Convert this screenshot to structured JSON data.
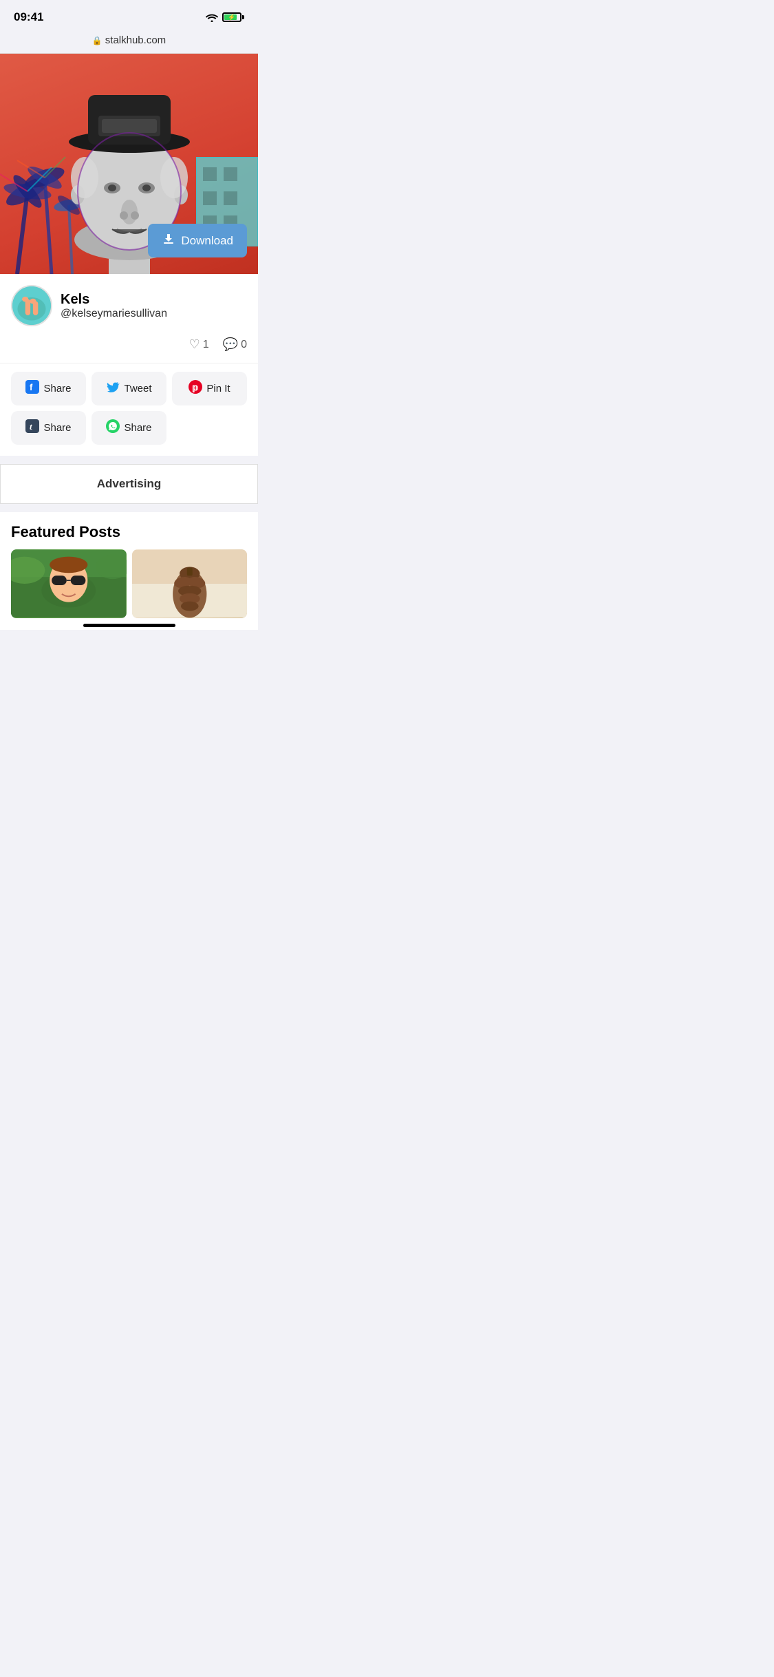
{
  "statusBar": {
    "time": "09:41",
    "wifi": "wifi",
    "battery": "battery"
  },
  "urlBar": {
    "lock": "🔒",
    "url": "stalkhub.com"
  },
  "hero": {
    "downloadButton": "Download"
  },
  "profile": {
    "name": "Kels",
    "handle": "@kelseymariesullivan",
    "likes": "1",
    "comments": "0"
  },
  "shareButtons": [
    {
      "id": "facebook",
      "label": "Share",
      "iconType": "facebook"
    },
    {
      "id": "twitter",
      "label": "Tweet",
      "iconType": "twitter"
    },
    {
      "id": "pinterest",
      "label": "Pin It",
      "iconType": "pinterest"
    },
    {
      "id": "tumblr",
      "label": "Share",
      "iconType": "tumblr"
    },
    {
      "id": "whatsapp",
      "label": "Share",
      "iconType": "whatsapp"
    }
  ],
  "advertising": {
    "label": "Advertising"
  },
  "featuredPosts": {
    "title": "Featured Posts"
  },
  "colors": {
    "heroBackground": "#e05a45",
    "downloadButton": "#5b9bd5",
    "facebook": "#1877f2",
    "twitter": "#1da1f2",
    "pinterest": "#e60023",
    "whatsapp": "#25d366"
  }
}
